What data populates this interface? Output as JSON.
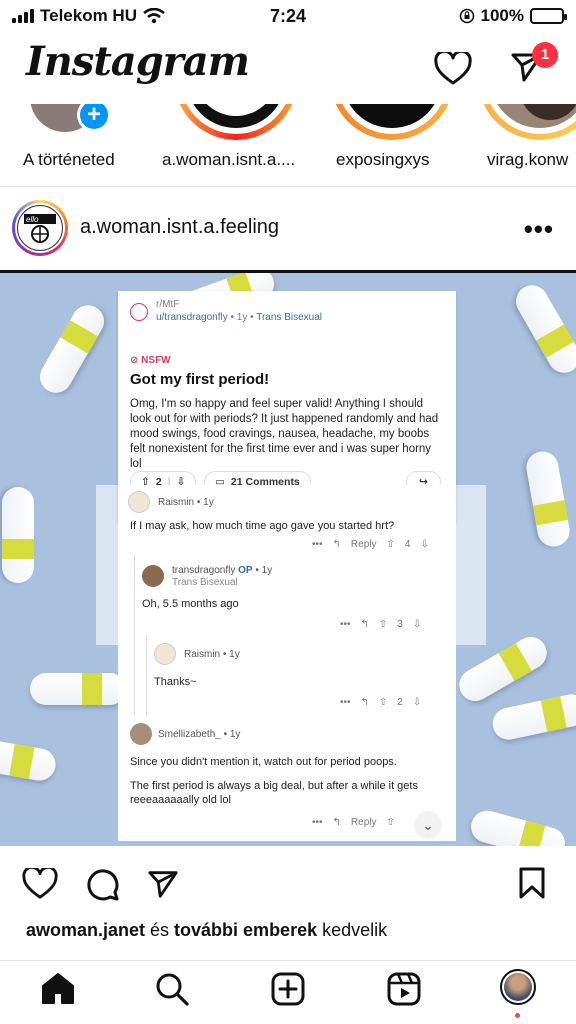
{
  "status_bar": {
    "carrier": "Telekom HU",
    "time": "7:24",
    "battery": "100%"
  },
  "app": {
    "logo": "Instagram",
    "messages_badge": "1"
  },
  "stories": [
    {
      "label": "A történeted"
    },
    {
      "label": "a.woman.isnt.a...."
    },
    {
      "label": "exposingxys"
    },
    {
      "label": "virag.konw"
    }
  ],
  "post": {
    "username": "a.woman.isnt.a.feeling",
    "more": "•••",
    "likes_user": "awoman.janet",
    "likes_connector": " és ",
    "likes_others": "további emberek",
    "likes_suffix": " kedvelik"
  },
  "reddit": {
    "subreddit": "r/MtF",
    "author": "u/transdragonfly",
    "age": " • 1y • ",
    "flair": "Trans Bisexual",
    "nsfw": "NSFW",
    "title": "Got my first period!",
    "body": "Omg, I'm so happy and feel super valid! Anything I should look out for with periods? It just happened randomly and had mood swings, food cravings, nausea, headache, my boobs felt nonexistent for the first time ever and i was super horny lol",
    "votes": "2",
    "comments": "21 Comments",
    "c1_name": "Raismin • 1y",
    "c1_text": "If I may ask, how much time ago gave you started hrt?",
    "c1_reply": "Reply",
    "c1_votes": "4",
    "c2_name": "transdragonfly",
    "c2_op": "OP",
    "c2_age": " • 1y",
    "c2_flair": "Trans Bisexual",
    "c2_text": "Oh, 5.5 months ago",
    "c2_votes": "3",
    "c3_name": "Raismin • 1y",
    "c3_text": "Thanks~",
    "c3_votes": "2",
    "c4_name": "Smellizabeth_ • 1y",
    "c4_text1": "Since you didn't mention it, watch out for period poops.",
    "c4_text2": "The first period is always a big deal, but after a while it gets reeeaaaaaally old lol",
    "c4_reply": "Reply"
  }
}
